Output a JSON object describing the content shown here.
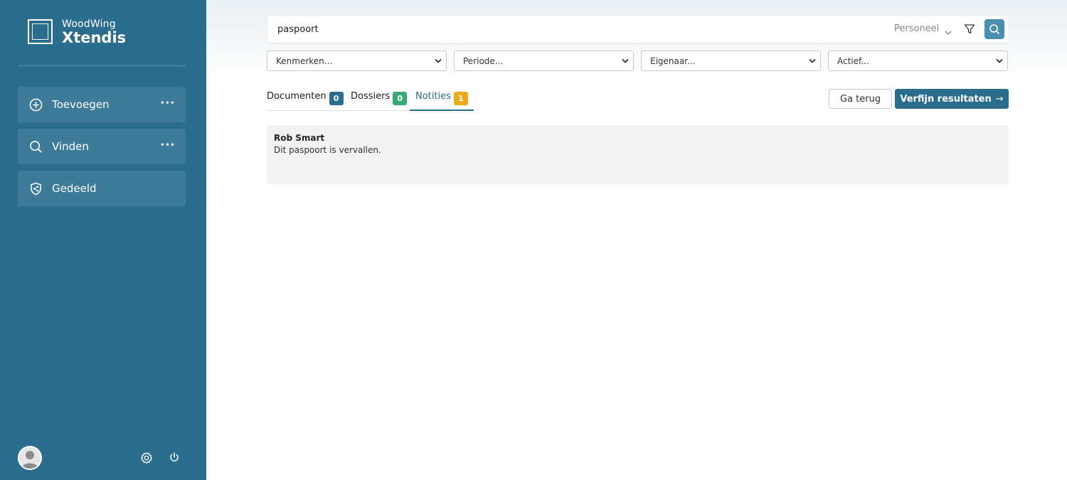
{
  "app": {
    "brand_top": "WoodWing",
    "brand_bottom": "Xtendis"
  },
  "sidebar": {
    "items": [
      {
        "label": "Toevoegen",
        "icon": "plus-circle-icon",
        "more": "•••"
      },
      {
        "label": "Vinden",
        "icon": "search-icon",
        "more": "•••"
      },
      {
        "label": "Gedeeld",
        "icon": "shield-share-icon"
      }
    ]
  },
  "search": {
    "value": "paspoort",
    "scope": "Personeel"
  },
  "filters": [
    {
      "label": "Kenmerken..."
    },
    {
      "label": "Periode..."
    },
    {
      "label": "Eigenaar..."
    },
    {
      "label": "Actief..."
    }
  ],
  "tabs": [
    {
      "label": "Documenten",
      "count": "0",
      "color": "#2b6d8c"
    },
    {
      "label": "Dossiers",
      "count": "0",
      "color": "#3aa876"
    },
    {
      "label": "Notities",
      "count": "1",
      "color": "#f0a81c",
      "active": true
    }
  ],
  "actions": {
    "back": "Ga terug",
    "refine": "Verfijn resultaten",
    "refine_arrow": "→"
  },
  "results": [
    {
      "author": "Rob Smart",
      "text": "Dit paspoort is vervallen."
    }
  ],
  "colors": {
    "sidebar": "#2b6d8c",
    "nav_item": "#3d7b98",
    "accent": "#2b6d8c"
  }
}
